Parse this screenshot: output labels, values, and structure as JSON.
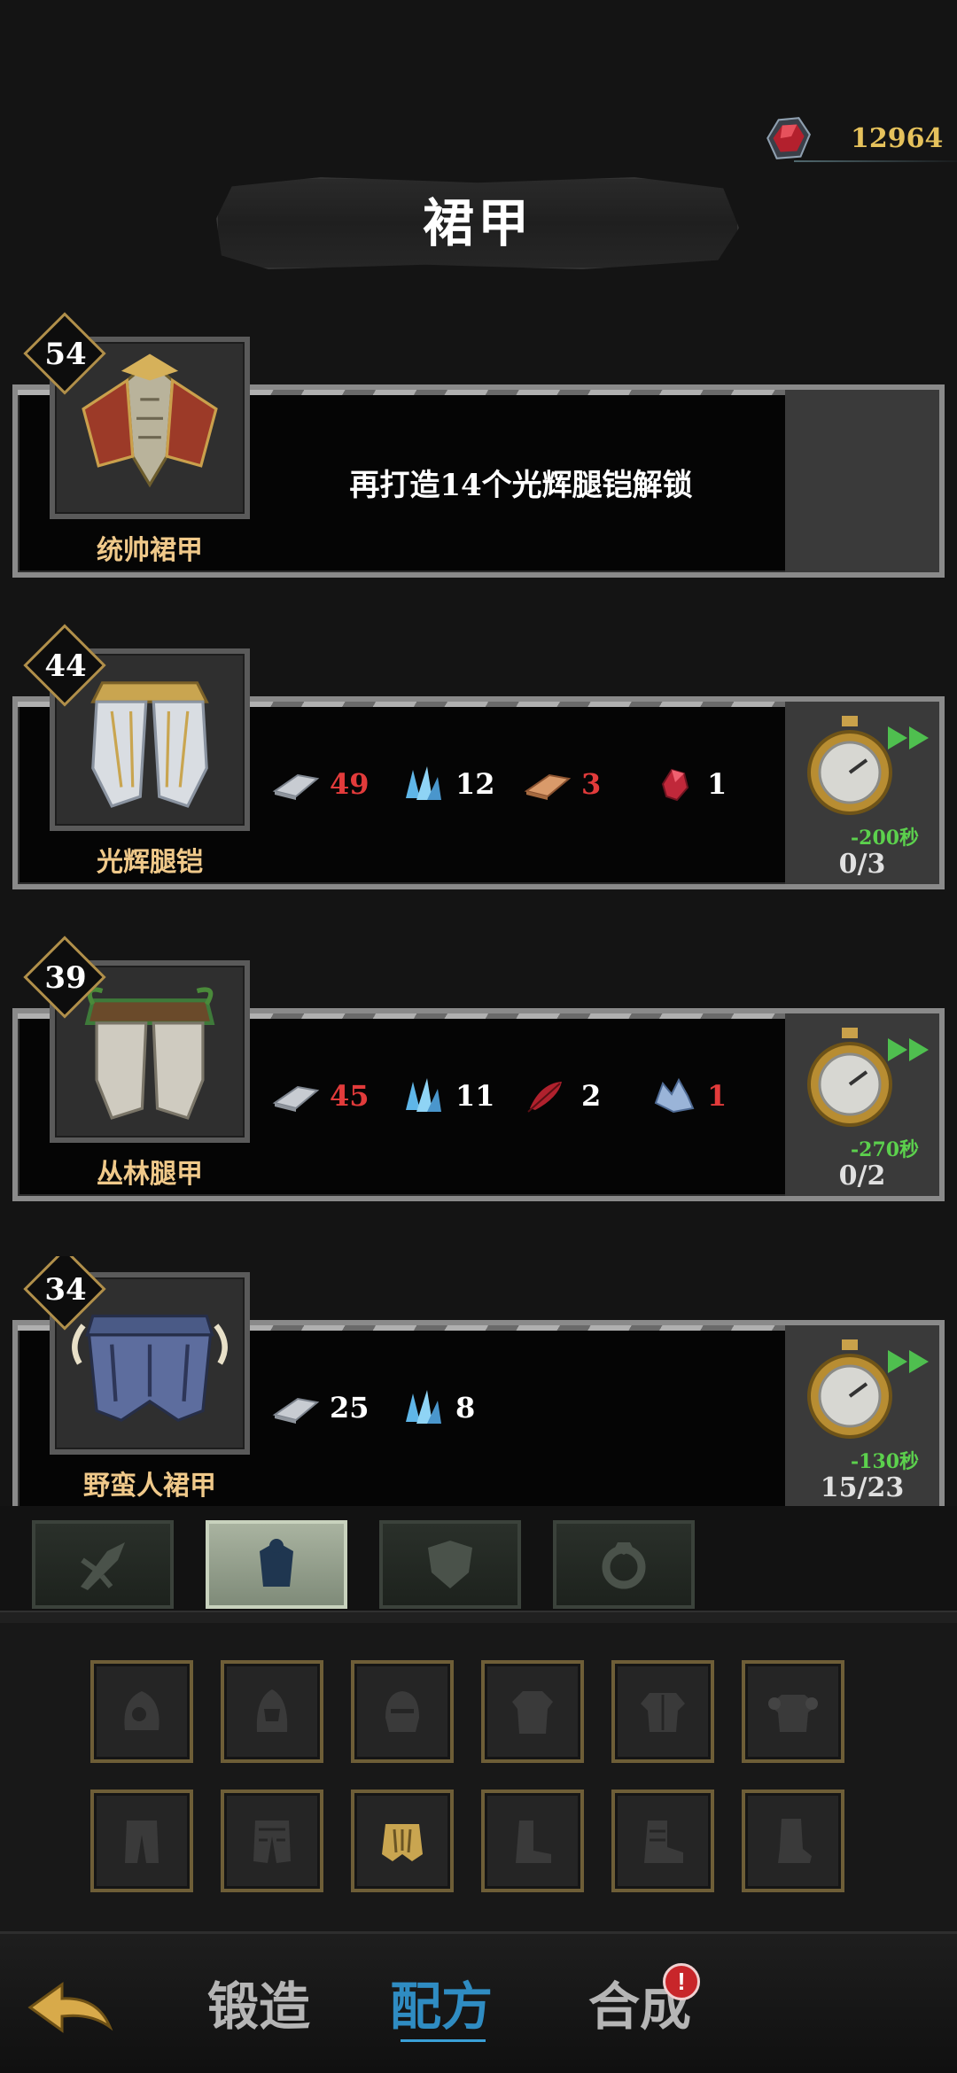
{
  "currency": {
    "icon": "red-gem-icon",
    "value": "12964"
  },
  "title": "裙甲",
  "recipes": [
    {
      "level": "54",
      "name": "统帅裙甲",
      "icon": "commander-skirt-armor-icon",
      "locked": true,
      "unlock_text": "再打造14个光辉腿铠解锁"
    },
    {
      "level": "44",
      "name": "光辉腿铠",
      "icon": "radiant-leg-armor-icon",
      "materials": [
        {
          "icon": "iron-ingot-icon",
          "qty": "49",
          "insufficient": true
        },
        {
          "icon": "blue-crystal-icon",
          "qty": "12",
          "insufficient": false
        },
        {
          "icon": "copper-ingot-icon",
          "qty": "3",
          "insufficient": true
        },
        {
          "icon": "red-gem-icon",
          "qty": "1",
          "insufficient": false
        }
      ],
      "time_cut": "-200秒",
      "count": "0/3"
    },
    {
      "level": "39",
      "name": "丛林腿甲",
      "icon": "jungle-leg-armor-icon",
      "materials": [
        {
          "icon": "iron-ingot-icon",
          "qty": "45",
          "insufficient": true
        },
        {
          "icon": "blue-crystal-icon",
          "qty": "11",
          "insufficient": false
        },
        {
          "icon": "red-feather-icon",
          "qty": "2",
          "insufficient": false
        },
        {
          "icon": "ice-shard-icon",
          "qty": "1",
          "insufficient": true
        }
      ],
      "time_cut": "-270秒",
      "count": "0/2"
    },
    {
      "level": "34",
      "name": "野蛮人裙甲",
      "icon": "barbarian-skirt-armor-icon",
      "materials": [
        {
          "icon": "iron-ingot-icon",
          "qty": "25",
          "insufficient": false
        },
        {
          "icon": "blue-crystal-icon",
          "qty": "8",
          "insufficient": false
        }
      ],
      "time_cut": "-130秒",
      "count": "15/23"
    }
  ],
  "category_tabs": [
    "weapon-tab-icon",
    "armor-tab-icon",
    "shield-tab-icon",
    "accessory-tab-icon"
  ],
  "slots": [
    "hood-icon",
    "hood-icon",
    "helmet-icon",
    "robe-icon",
    "chest-armor-icon",
    "pauldron-armor-icon",
    "pants-icon",
    "leg-armor-icon",
    "skirt-armor-icon",
    "boot-icon",
    "armored-boot-icon",
    "greave-icon"
  ],
  "nav": {
    "forge": "锻造",
    "recipe": "配方",
    "combine": "合成",
    "badge": "!"
  },
  "colors": {
    "gold": "#e6c25c",
    "red": "#e23b3b",
    "green": "#5cd14d",
    "active_blue": "#2f8cc2"
  }
}
